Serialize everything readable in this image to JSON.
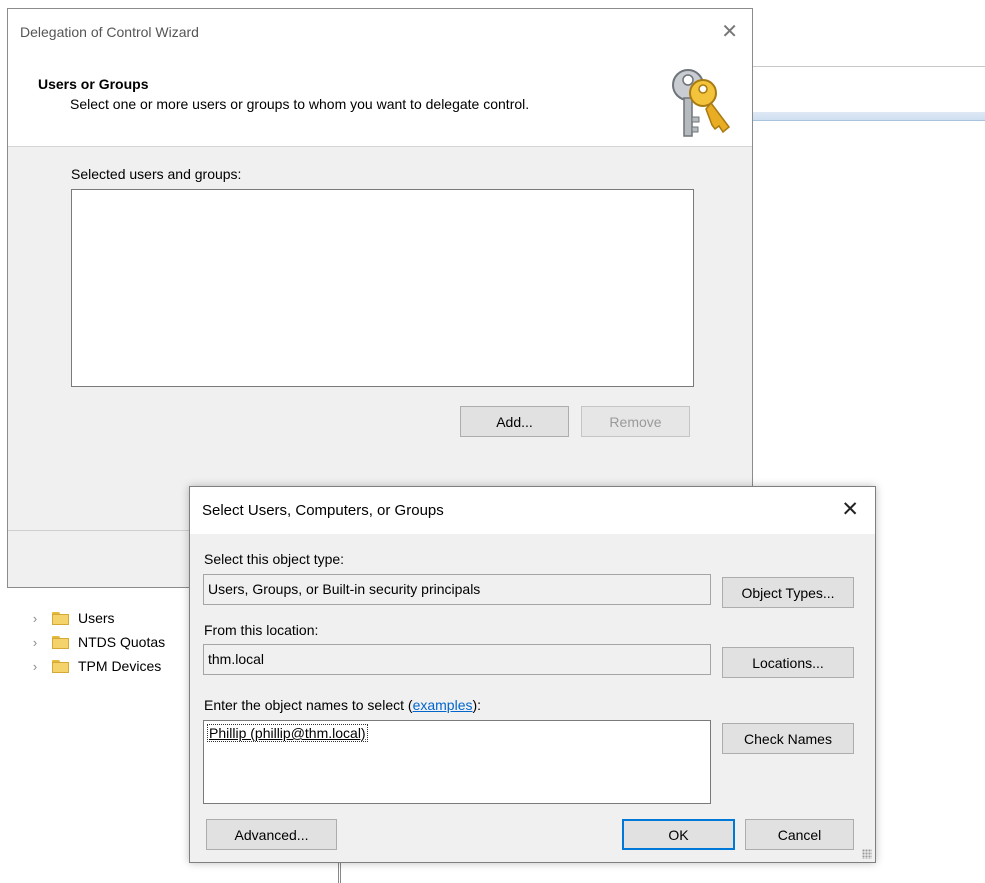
{
  "background": {
    "tree_items": [
      {
        "label": "Users"
      },
      {
        "label": "NTDS Quotas"
      },
      {
        "label": "TPM Devices"
      }
    ]
  },
  "wizard": {
    "title": "Delegation of Control Wizard",
    "close_glyph": "✕",
    "heading": "Users or Groups",
    "subheading": "Select one or more users or groups to whom you want to delegate control.",
    "icon": "keys-icon",
    "selected_label": "Selected users and groups:",
    "add_label": "Add...",
    "remove_label": "Remove"
  },
  "dialog": {
    "title": "Select Users, Computers, or Groups",
    "close_glyph": "✕",
    "object_type_label": "Select this object type:",
    "object_type_value": "Users, Groups, or Built-in security principals",
    "object_types_button": "Object Types...",
    "location_label": "From this location:",
    "location_value": "thm.local",
    "locations_button": "Locations...",
    "names_label_prefix": "Enter the object names to select (",
    "names_label_link": "examples",
    "names_label_suffix": "):",
    "names_value": "Phillip (phillip@thm.local)",
    "check_names_button": "Check Names",
    "advanced_button": "Advanced...",
    "ok_button": "OK",
    "cancel_button": "Cancel"
  },
  "colors": {
    "accent": "#0078d7",
    "link": "#0066cc",
    "folder": "#f4d36b"
  }
}
